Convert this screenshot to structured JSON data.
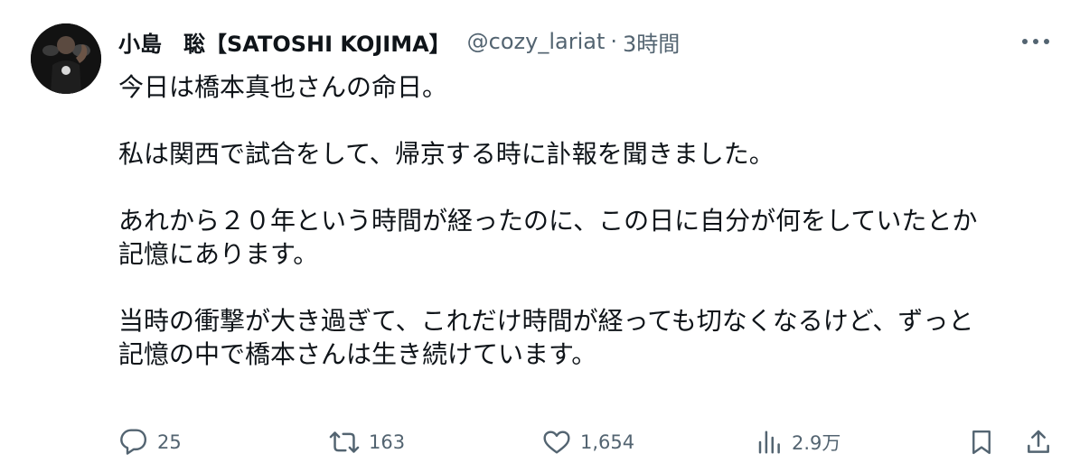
{
  "tweet": {
    "author": {
      "display_name": "小島　聡【SATOSHI KOJIMA】",
      "handle": "@cozy_lariat",
      "separator": "·",
      "timestamp": "3時間",
      "avatar_icon": "profile-photo"
    },
    "text": {
      "p1": "今日は橋本真也さんの命日。",
      "p2": "私は関西で試合をして、帰京する時に訃報を聞きました。",
      "p3_line1": "あれから２０年という時間が経ったのに、この日に自分が何をしていたとか",
      "p3_line2": "記憶にあります。",
      "p4_line1": "当時の衝撃が大き過ぎて、これだけ時間が経っても切なくなるけど、ずっと",
      "p4_line2": "記憶の中で橋本さんは生き続けています。"
    },
    "actions": {
      "reply_count": "25",
      "retweet_count": "163",
      "like_count": "1,654",
      "views_count": "2.9万"
    },
    "icons": {
      "reply": "reply-icon",
      "retweet": "retweet-icon",
      "like": "heart-icon",
      "views": "views-icon",
      "bookmark": "bookmark-icon",
      "share": "share-icon",
      "more": "more-icon"
    },
    "colors": {
      "text": "#0f1419",
      "secondary": "#536471",
      "background": "#ffffff"
    }
  }
}
